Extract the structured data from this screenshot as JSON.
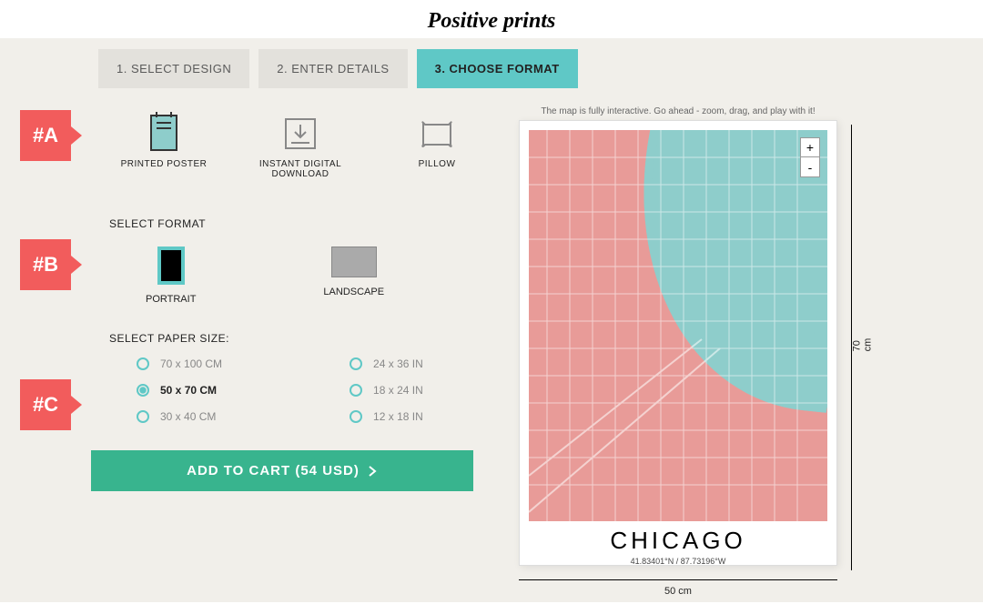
{
  "logo": "Positive prints",
  "tabs": [
    "1. SELECT DESIGN",
    "2. ENTER DETAILS",
    "3. CHOOSE FORMAT"
  ],
  "active_tab": 2,
  "markers": [
    "#A",
    "#B",
    "#C"
  ],
  "product_types": [
    {
      "label": "PRINTED POSTER"
    },
    {
      "label": "INSTANT DIGITAL DOWNLOAD"
    },
    {
      "label": "PILLOW"
    }
  ],
  "format": {
    "title": "SELECT FORMAT",
    "options": [
      "PORTRAIT",
      "LANDSCAPE"
    ]
  },
  "paper_size": {
    "title": "SELECT PAPER SIZE:",
    "col1": [
      "70 x 100 CM",
      "50 x 70 CM",
      "30 x 40 CM"
    ],
    "col2": [
      "24 x 36 IN",
      "18 x 24 IN",
      "12 x 18 IN"
    ],
    "selected": "50 x 70 CM"
  },
  "cart_button": "ADD TO CART (54 USD)",
  "preview": {
    "hint": "The map is fully interactive. Go ahead - zoom, drag, and play with it!",
    "zoom_in": "+",
    "zoom_out": "-",
    "city": "CHICAGO",
    "coords": "41.83401°N / 87.73196°W",
    "dim_w": "50 cm",
    "dim_h": "70 cm"
  }
}
